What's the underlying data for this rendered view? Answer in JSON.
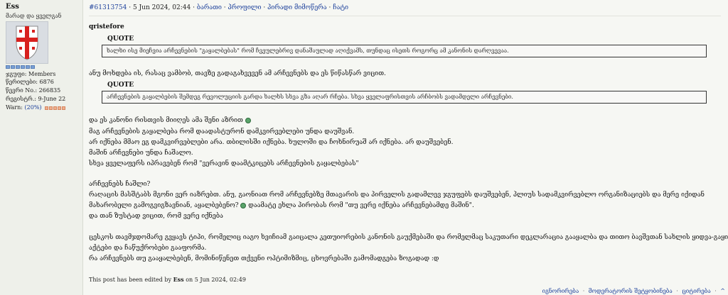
{
  "author": {
    "name": "Ess",
    "title": "მარად და ყველგან",
    "group_label": "ჯგუფი:",
    "group_value": "Members",
    "posts_label": "წერილები:",
    "posts_value": "6876",
    "member_no_label": "წევრი No.:",
    "member_no_value": "266835",
    "registered_label": "რეგისტრ.:",
    "registered_value": "9-June 22",
    "warn_label": "Warn:",
    "warn_value": "(20%)"
  },
  "post": {
    "id": "#61313754",
    "date": "5 Jun 2024, 02:44",
    "separator": "·",
    "actions": [
      "ბარათი",
      "პროფილი",
      "პირადი მიმოწერა",
      "ჩატი"
    ],
    "quoted_author": "qristefore",
    "quote_label": "QUOTE",
    "quote1": "ხალხი ისე მიეჩვია არჩევნების \"გაყალბებას\" რომ ჩვეულებრივ დანაშაულად აღიქვამს, თუნდაც ისეთს როგორც ამ კანონის დარღვევაა.",
    "after_quote1": "ანუ მოხდება ის, რასაც ვამბობ, თავზე გადაგახვევენ ამ არჩევნებს და ეს წიწასწარ ვიცით.",
    "quote2": "არჩევნების გაყალბების შემდეგ რევოლუციის გარდა ხალხს სხვა გზა აღარ რჩება. სხვა ყველაფრისთვის არჩბობს ვადამდელი არჩევნები.",
    "lines_a": [
      "და ეს კანონი რისთვის მიიღეს ამა შენი აზრით",
      "მაგ არჩევნების გაყალბება რომ დაადასტურონ დამკვირვებლები უნდა დაუშვან.",
      "არ იქნება მმაო ეგ დამკვირვებლები არა. თბილისში იქნება. ხულოში და ჩოხნირუაშ არ იქნება. არ დაუშვებენ.",
      "მაშინ არჩევნები უნდა ჩაშალო.",
      "სხვა ყველაფერს იპრავებენ რომ \"ვერავინ დაამტკიცებს არჩევნების გაყალბებას\""
    ],
    "lines_b": [
      "არჩევნებს ჩაშლი?",
      "რაღაცის მასშტაბს მგონი ვერ იაზრებთ. ანუ, გაონიათ რომ არჩევნებზე მთავარის და პირველის გადამლევ ჯგუფებს დაუშვებენ, პლიუს სადამკვირვებლო ორგანიზაციებს და მერე იქიდან",
      "მახარობელი გამოგვიგზავნიან, აყალბებენო?",
      "დაამატე ეხლა პირობას რომ \"თუ ვერე იქნება არჩევნებამდე მაშინ\".",
      "და თან ზუსტად ვიცით, რომ ვერე იქნება"
    ],
    "lines_c": [
      "ცესკოს თავმჯდომარე გვყავს ტიპი, რომელიც იაგო ხვიჩიამ გაიცალა კეთუიორების კანონის გაუქმებაში და რომელმაც საკუთარი დეკლარაცია გააყალბა და თითო ბავშვთან სახლის ყიდვა-გაყიდვის",
      "აქტები და ჩაწუქრობები გააფორმა.",
      "რა არჩევნებს თუ გააყალბებენ, მომინიწენეთ თქვენი ოპტიმიზმიც, ცხოვრებაში გამომადგება ზოგადად :დ"
    ],
    "edited_prefix": "This post has been edited by",
    "edited_by": "Ess",
    "edited_suffix": "on 5 Jun 2024, 02:49"
  },
  "footer": {
    "links": [
      "იგნორირება",
      "მოდერატორის შეტყობინება",
      "ციტირება"
    ],
    "top_symbol": "^"
  },
  "icons": {
    "avatar": "georgian-flag-shield-avatar",
    "smiley": "globe-smiley-icon"
  }
}
